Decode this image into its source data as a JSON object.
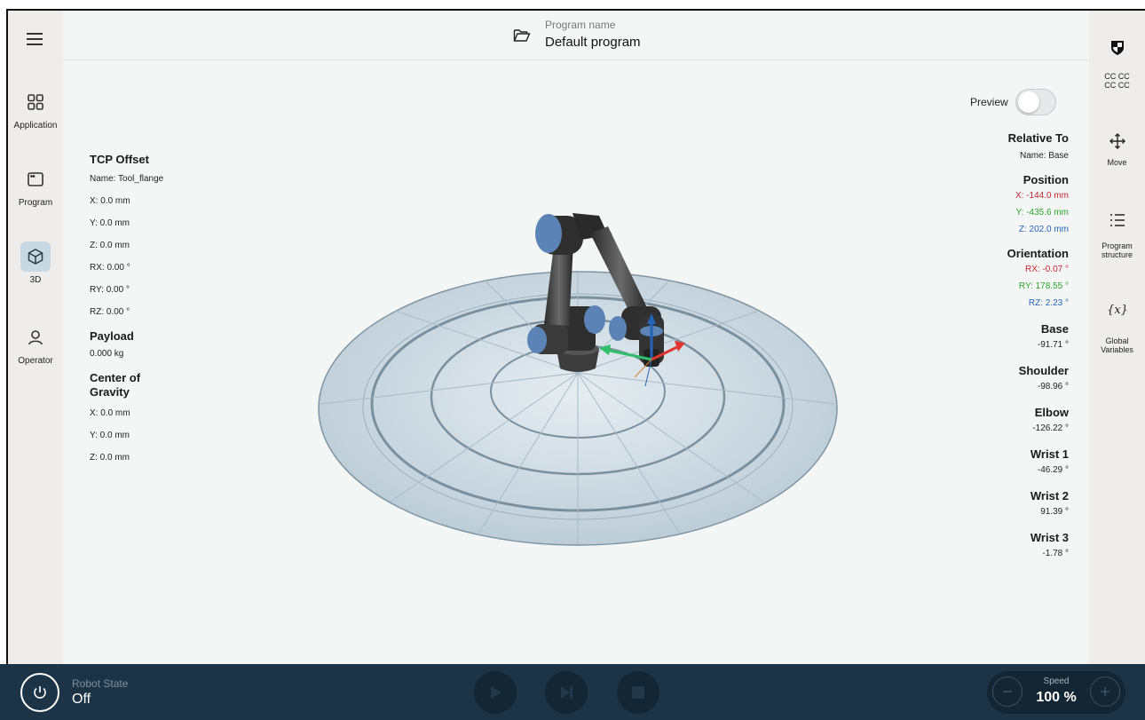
{
  "header": {
    "program_name_label": "Program name",
    "program_name": "Default program"
  },
  "left_nav": {
    "items": [
      {
        "label": "Application",
        "icon": "grid-icon"
      },
      {
        "label": "Program",
        "icon": "window-icon"
      },
      {
        "label": "3D",
        "icon": "cube-icon",
        "active": true
      },
      {
        "label": "Operator",
        "icon": "person-icon"
      }
    ]
  },
  "right_nav": {
    "items": [
      {
        "label": "CC CC\nCC CC",
        "label1": "CC CC",
        "label2": "CC CC",
        "icon": "shield-icon"
      },
      {
        "label": "Move",
        "icon": "move-arrows-icon"
      },
      {
        "label": "Program structure",
        "label1": "Program",
        "label2": "structure",
        "icon": "list-icon"
      },
      {
        "label": "Global Variables",
        "label1": "Global",
        "label2": "Variables",
        "icon": "variable-x-icon"
      }
    ]
  },
  "preview": {
    "label": "Preview",
    "on": false
  },
  "tcp": {
    "title": "TCP Offset",
    "name": "Name: Tool_flange",
    "x": "X: 0.0 mm",
    "y": "Y: 0.0 mm",
    "z": "Z: 0.0 mm",
    "rx": "RX: 0.00 °",
    "ry": "RY: 0.00 °",
    "rz": "RZ: 0.00 °"
  },
  "payload": {
    "title": "Payload",
    "value": "0.000 kg"
  },
  "cog": {
    "title1": "Center of",
    "title2": "Gravity",
    "x": "X: 0.0 mm",
    "y": "Y: 0.0 mm",
    "z": "Z: 0.0 mm"
  },
  "relative_to": {
    "title": "Relative To",
    "name": "Name: Base"
  },
  "position": {
    "title": "Position",
    "x": "X: -144.0 mm",
    "y": "Y: -435.6 mm",
    "z": "Z: 202.0 mm"
  },
  "orientation": {
    "title": "Orientation",
    "rx": "RX: -0.07 °",
    "ry": "RY: 178.55 °",
    "rz": "RZ: 2.23 °"
  },
  "joints": [
    {
      "name": "Base",
      "value": "-91.71 °"
    },
    {
      "name": "Shoulder",
      "value": "-98.96 °"
    },
    {
      "name": "Elbow",
      "value": "-126.22 °"
    },
    {
      "name": "Wrist 1",
      "value": "-46.29 °"
    },
    {
      "name": "Wrist 2",
      "value": "91.39 °"
    },
    {
      "name": "Wrist 3",
      "value": "-1.78 °"
    }
  ],
  "colors": {
    "x_axis": "#c0262d",
    "y_axis": "#2aa52b",
    "z_axis": "#2463b8",
    "footer": "#1c3446"
  },
  "footer": {
    "robot_state_label": "Robot State",
    "robot_state": "Off",
    "speed_label": "Speed",
    "speed_value": "100 %"
  }
}
